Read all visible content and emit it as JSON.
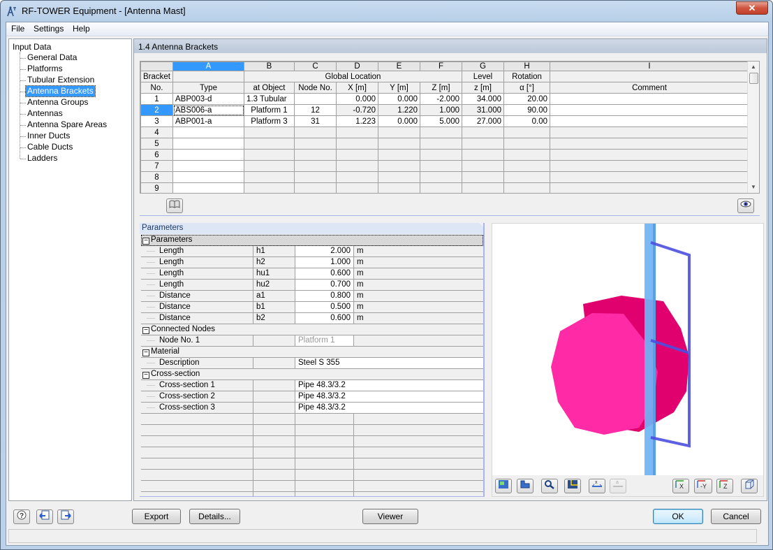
{
  "window": {
    "title": "RF-TOWER Equipment - [Antenna Mast]",
    "close_label": "✕"
  },
  "menu": [
    "File",
    "Settings",
    "Help"
  ],
  "tree": {
    "root": "Input Data",
    "items": [
      {
        "label": "General Data"
      },
      {
        "label": "Platforms"
      },
      {
        "label": "Tubular Extension"
      },
      {
        "label": "Antenna Brackets",
        "selected": true
      },
      {
        "label": "Antenna Groups"
      },
      {
        "label": "Antennas"
      },
      {
        "label": "Antenna Spare Areas"
      },
      {
        "label": "Inner Ducts"
      },
      {
        "label": "Cable Ducts"
      },
      {
        "label": "Ladders"
      }
    ]
  },
  "section_title": "1.4 Antenna Brackets",
  "table": {
    "column_letters": [
      "A",
      "B",
      "C",
      "D",
      "E",
      "F",
      "G",
      "H",
      "I"
    ],
    "rowno_header": [
      "Bracket",
      "No."
    ],
    "group_headers": {
      "global_location": "Global Location",
      "level": "Level",
      "rotation": "Rotation"
    },
    "headers": [
      "Type",
      "at Object",
      "Node No.",
      "X [m]",
      "Y [m]",
      "Z [m]",
      "z [m]",
      "α [°]",
      "Comment"
    ],
    "rows": [
      {
        "no": "1",
        "type": "ABP003-d",
        "at_object": "1.3 Tubular",
        "node": "",
        "x": "0.000",
        "y": "0.000",
        "z": "-2.000",
        "level": "34.000",
        "rotation": "20.00",
        "comment": ""
      },
      {
        "no": "2",
        "type": "ABS006-a",
        "at_object": "Platform 1",
        "node": "12",
        "x": "-0.720",
        "y": "1.220",
        "z": "1.000",
        "level": "31.000",
        "rotation": "90.00",
        "comment": "",
        "selected": true
      },
      {
        "no": "3",
        "type": "ABP001-a",
        "at_object": "Platform 3",
        "node": "31",
        "x": "1.223",
        "y": "0.000",
        "z": "5.000",
        "level": "27.000",
        "rotation": "0.00",
        "comment": ""
      }
    ],
    "empty_rows": [
      "4",
      "5",
      "6",
      "7",
      "8",
      "9"
    ]
  },
  "params": {
    "title": "Parameters",
    "groups": [
      {
        "name": "Parameters",
        "rows": [
          {
            "label": "Length",
            "sym": "h1",
            "value": "2.000",
            "unit": "m"
          },
          {
            "label": "Length",
            "sym": "h2",
            "value": "1.000",
            "unit": "m"
          },
          {
            "label": "Length",
            "sym": "hu1",
            "value": "0.600",
            "unit": "m"
          },
          {
            "label": "Length",
            "sym": "hu2",
            "value": "0.700",
            "unit": "m"
          },
          {
            "label": "Distance",
            "sym": "a1",
            "value": "0.800",
            "unit": "m"
          },
          {
            "label": "Distance",
            "sym": "b1",
            "value": "0.500",
            "unit": "m"
          },
          {
            "label": "Distance",
            "sym": "b2",
            "value": "0.600",
            "unit": "m"
          }
        ]
      },
      {
        "name": "Connected Nodes",
        "rows": [
          {
            "label": "Node No. 1",
            "value": "Platform 1"
          }
        ]
      },
      {
        "name": "Material",
        "rows": [
          {
            "label": "Description",
            "value": "Steel S 355"
          }
        ]
      },
      {
        "name": "Cross-section",
        "rows": [
          {
            "label": "Cross-section 1",
            "value": "Pipe 48.3/3.2"
          },
          {
            "label": "Cross-section 2",
            "value": "Pipe 48.3/3.2"
          },
          {
            "label": "Cross-section 3",
            "value": "Pipe 48.3/3.2"
          }
        ]
      }
    ]
  },
  "viewer_toolbar": {
    "x_label": "X",
    "y_label": "-Y",
    "z_label": "Z"
  },
  "colors": {
    "selection": "#3399ff",
    "antenna": "#ff2aa6",
    "mast": "#6fb3f5",
    "bracket": "#4c4fe0"
  },
  "buttons": {
    "export": "Export",
    "details": "Details...",
    "viewer": "Viewer",
    "ok": "OK",
    "cancel": "Cancel"
  }
}
